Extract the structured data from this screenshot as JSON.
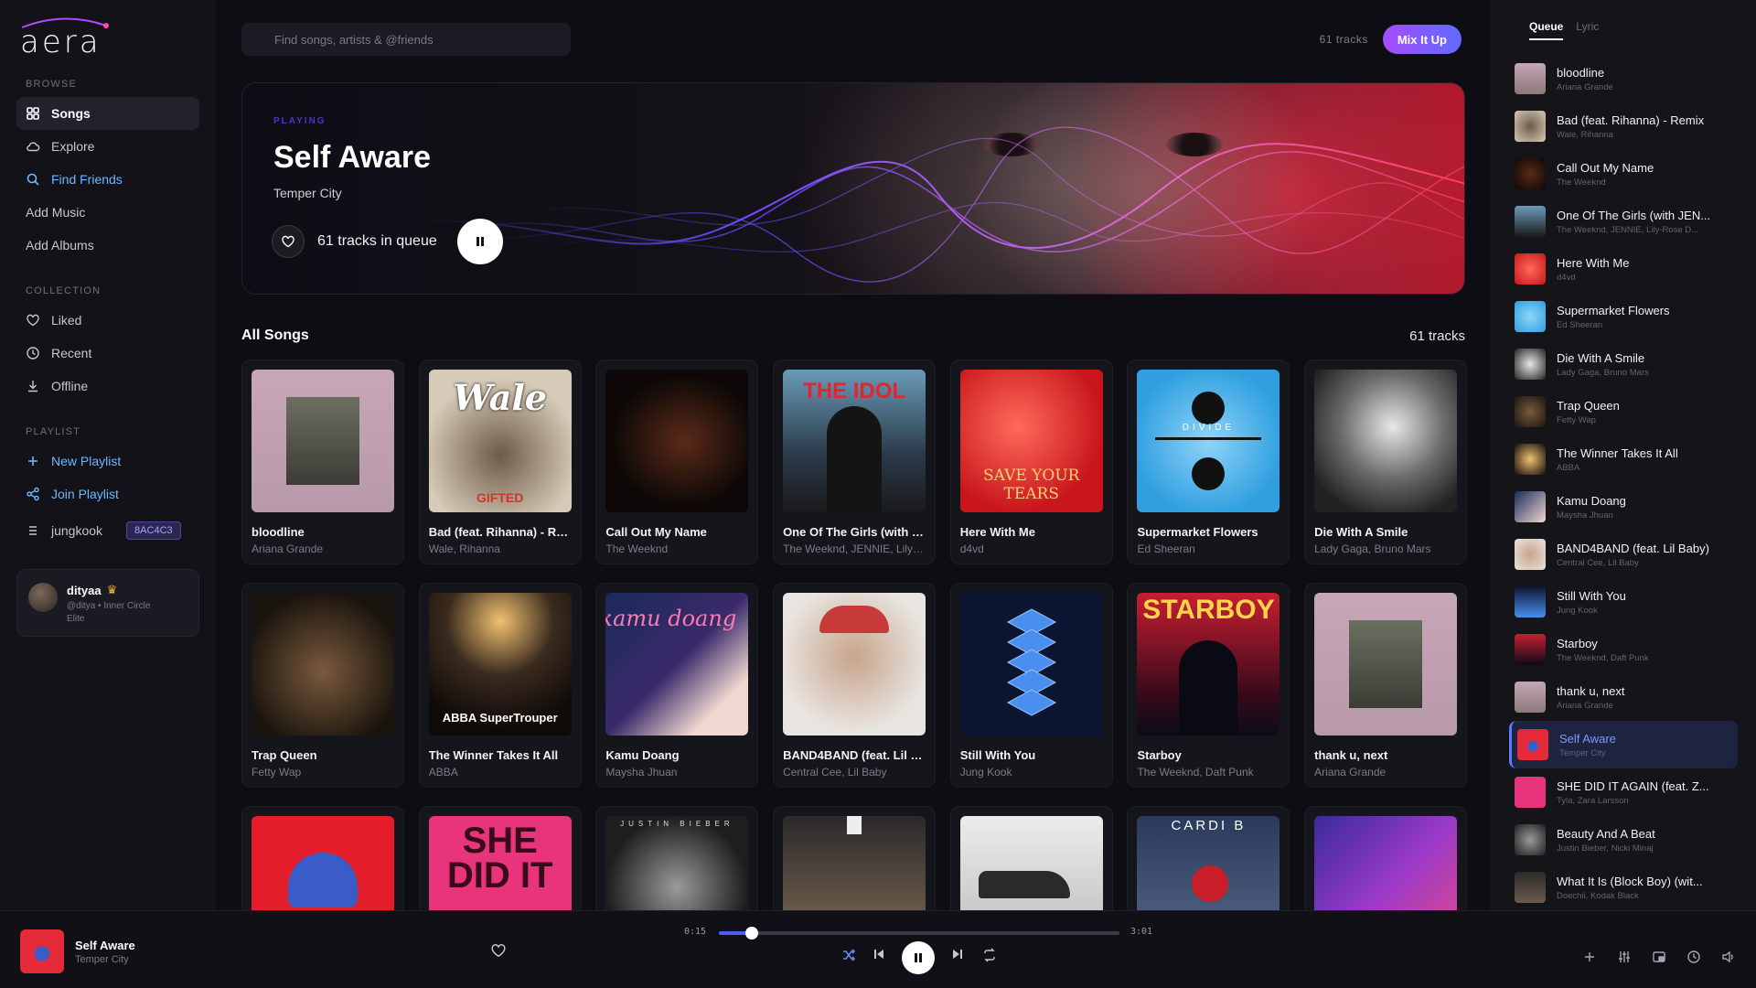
{
  "app": {
    "logo": "aera"
  },
  "sidebar": {
    "browse_label": "BROWSE",
    "browse": [
      {
        "label": "Songs",
        "icon": "grid-icon"
      },
      {
        "label": "Explore",
        "icon": "cloud-icon"
      },
      {
        "label": "Find Friends",
        "icon": "search-icon"
      },
      {
        "label": "Add Music",
        "icon": ""
      },
      {
        "label": "Add Albums",
        "icon": ""
      }
    ],
    "collection_label": "COLLECTION",
    "collection": [
      {
        "label": "Liked",
        "icon": "heart-icon"
      },
      {
        "label": "Recent",
        "icon": "clock-icon"
      },
      {
        "label": "Offline",
        "icon": "download-icon"
      }
    ],
    "playlist_label": "PLAYLIST",
    "playlist": [
      {
        "label": "New Playlist",
        "icon": "plus-icon"
      },
      {
        "label": "Join Playlist",
        "icon": "share-icon"
      }
    ],
    "playlist_item": {
      "label": "jungkook",
      "code": "8AC4C3"
    },
    "user": {
      "name": "dityaa",
      "handle": "@ditya • Inner Circle Elite"
    }
  },
  "top": {
    "search_placeholder": "Find songs, artists & @friends",
    "tracks": "61 tracks",
    "mix_label": "Mix It Up"
  },
  "hero": {
    "playing_label": "PLAYING",
    "title": "Self Aware",
    "artist": "Temper City",
    "queue_text": "61 tracks in queue"
  },
  "all_songs": {
    "title": "All Songs",
    "count": "61 tracks",
    "cards": [
      {
        "title": "bloodline",
        "artist": "Ariana Grande"
      },
      {
        "title": "Bad (feat. Rihanna) - Re...",
        "artist": "Wale, Rihanna",
        "cover_text": "Wale",
        "cover_sub": "GIFTED"
      },
      {
        "title": "Call Out My Name",
        "artist": "The Weeknd"
      },
      {
        "title": "One Of The Girls (with J...",
        "artist": "The Weeknd, JENNIE, Lily-Ro...",
        "cover_text": "THE IDOL"
      },
      {
        "title": "Here With Me",
        "artist": "d4vd",
        "cover_text": "SAVE YOUR TEARS"
      },
      {
        "title": "Supermarket Flowers",
        "artist": "Ed Sheeran",
        "cover_text": "DIVIDE"
      },
      {
        "title": "Die With A Smile",
        "artist": "Lady Gaga, Bruno Mars"
      },
      {
        "title": "Trap Queen",
        "artist": "Fetty Wap"
      },
      {
        "title": "The Winner Takes It All",
        "artist": "ABBA",
        "cover_text": "ABBA SuperTrouper"
      },
      {
        "title": "Kamu Doang",
        "artist": "Maysha Jhuan",
        "cover_text": "kamu doang"
      },
      {
        "title": "BAND4BAND (feat. Lil B...",
        "artist": "Central Cee, Lil Baby"
      },
      {
        "title": "Still With You",
        "artist": "Jung Kook"
      },
      {
        "title": "Starboy",
        "artist": "The Weeknd, Daft Punk",
        "cover_text": "STARBOY"
      },
      {
        "title": "thank u, next",
        "artist": "Ariana Grande"
      },
      {
        "title": "",
        "artist": ""
      },
      {
        "title": "",
        "artist": "",
        "cover_text": "SHE DID IT"
      },
      {
        "title": "",
        "artist": "",
        "cover_text": "JUSTIN BIEBER"
      },
      {
        "title": "",
        "artist": ""
      },
      {
        "title": "",
        "artist": ""
      },
      {
        "title": "",
        "artist": "",
        "cover_text": "CARDI B"
      },
      {
        "title": "",
        "artist": ""
      }
    ]
  },
  "queue": {
    "tabs": [
      "Queue",
      "Lyric"
    ],
    "items": [
      {
        "title": "bloodline",
        "artist": "Ariana Grande"
      },
      {
        "title": "Bad (feat. Rihanna) - Remix",
        "artist": "Wale, Rihanna"
      },
      {
        "title": "Call Out My Name",
        "artist": "The Weeknd"
      },
      {
        "title": "One Of The Girls (with JEN...",
        "artist": "The Weeknd, JENNIE, Lily-Rose D..."
      },
      {
        "title": "Here With Me",
        "artist": "d4vd"
      },
      {
        "title": "Supermarket Flowers",
        "artist": "Ed Sheeran"
      },
      {
        "title": "Die With A Smile",
        "artist": "Lady Gaga, Bruno Mars"
      },
      {
        "title": "Trap Queen",
        "artist": "Fetty Wap"
      },
      {
        "title": "The Winner Takes It All",
        "artist": "ABBA"
      },
      {
        "title": "Kamu Doang",
        "artist": "Maysha Jhuan"
      },
      {
        "title": "BAND4BAND (feat. Lil Baby)",
        "artist": "Central Cee, Lil Baby"
      },
      {
        "title": "Still With You",
        "artist": "Jung Kook"
      },
      {
        "title": "Starboy",
        "artist": "The Weeknd, Daft Punk"
      },
      {
        "title": "thank u, next",
        "artist": "Ariana Grande"
      },
      {
        "title": "Self Aware",
        "artist": "Temper City"
      },
      {
        "title": "SHE DID IT AGAIN (feat. Z...",
        "artist": "Tyla, Zara Larsson"
      },
      {
        "title": "Beauty And A Beat",
        "artist": "Justin Bieber, Nicki Minaj"
      },
      {
        "title": "What It Is (Block Boy) (wit...",
        "artist": "Doechii, Kodak Black"
      }
    ]
  },
  "player": {
    "title": "Self Aware",
    "artist": "Temper City",
    "elapsed": "0:15",
    "duration": "3:01",
    "progress": 0.083
  },
  "colors": {
    "accent": "#4b5bff",
    "mix_gradient_start": "#a64cff",
    "mix_gradient_end": "#5f6bff",
    "find_friends": "#6db8ff"
  }
}
